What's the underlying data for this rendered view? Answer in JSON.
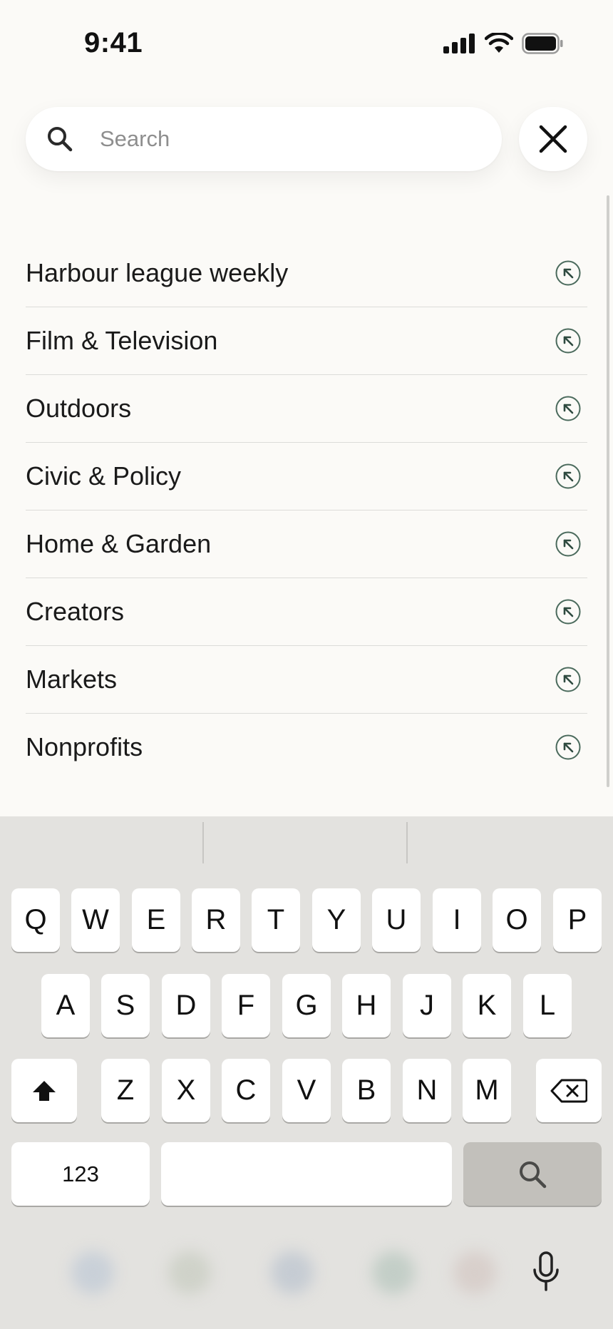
{
  "status_bar": {
    "time": "9:41",
    "icons": [
      "cellular-signal-icon",
      "wifi-icon",
      "battery-icon"
    ]
  },
  "search": {
    "placeholder": "Search",
    "value": "",
    "search_icon": "search-icon",
    "close_icon": "close-icon"
  },
  "suggestions": [
    {
      "label": "Harbour league weekly",
      "icon": "fill-arrow-icon"
    },
    {
      "label": "Film & Television",
      "icon": "fill-arrow-icon"
    },
    {
      "label": "Outdoors",
      "icon": "fill-arrow-icon"
    },
    {
      "label": "Civic & Policy",
      "icon": "fill-arrow-icon"
    },
    {
      "label": "Home & Garden",
      "icon": "fill-arrow-icon"
    },
    {
      "label": "Creators",
      "icon": "fill-arrow-icon"
    },
    {
      "label": "Markets",
      "icon": "fill-arrow-icon"
    },
    {
      "label": "Nonprofits",
      "icon": "fill-arrow-icon"
    }
  ],
  "keyboard": {
    "row1": [
      "Q",
      "W",
      "E",
      "R",
      "T",
      "Y",
      "U",
      "I",
      "O",
      "P"
    ],
    "row2": [
      "A",
      "S",
      "D",
      "F",
      "G",
      "H",
      "J",
      "K",
      "L"
    ],
    "row3": [
      "Z",
      "X",
      "C",
      "V",
      "B",
      "N",
      "M"
    ],
    "numbers_label": "123",
    "shift_icon": "shift-icon",
    "backspace_icon": "backspace-icon",
    "search_key_icon": "search-icon",
    "mic_icon": "microphone-icon"
  },
  "colors": {
    "background": "#fbfaf7",
    "keyboard_background": "#e3e2df",
    "search_key": "#c2c0bb",
    "fill_icon": "#4a6a5c"
  }
}
